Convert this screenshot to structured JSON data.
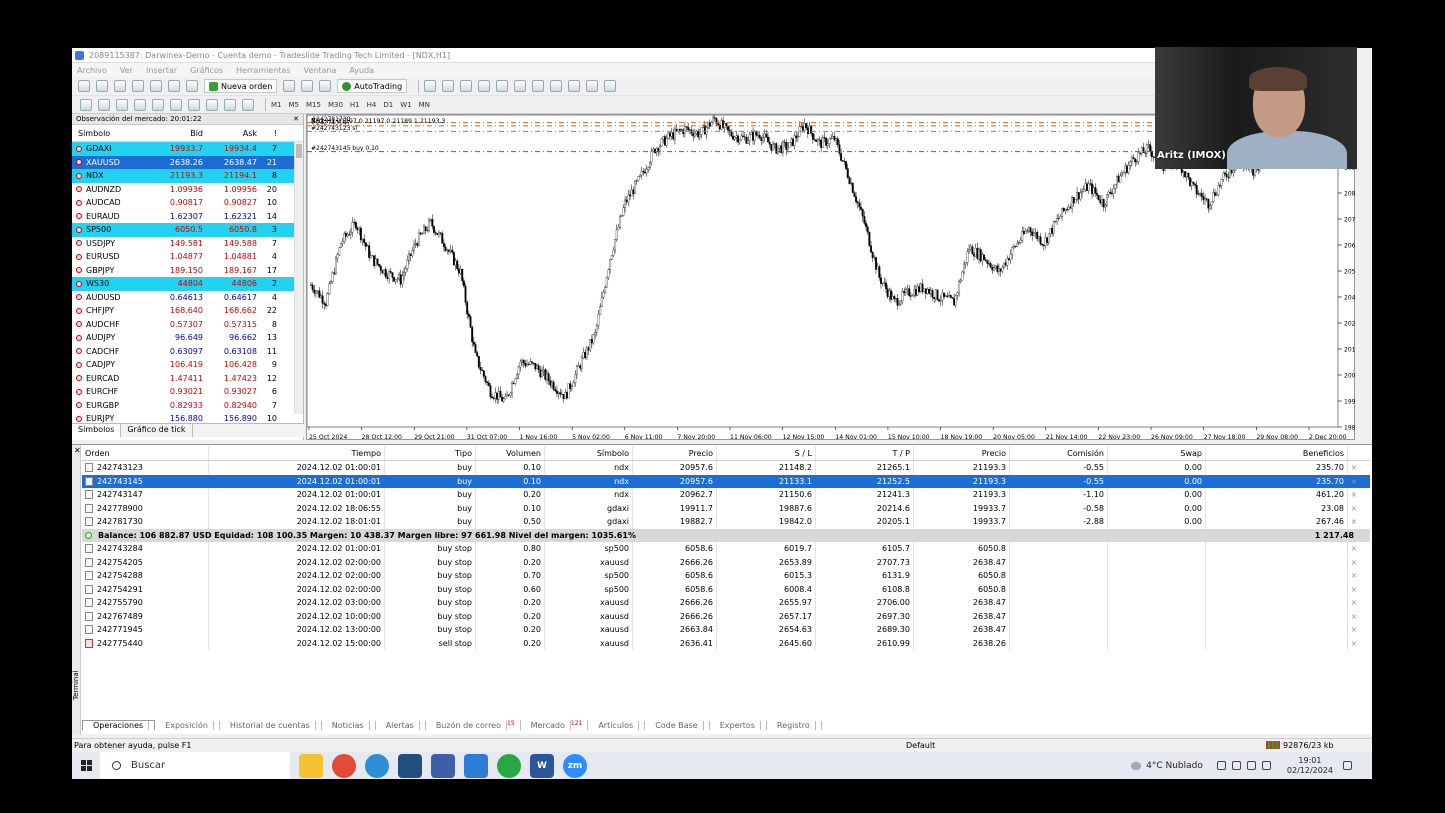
{
  "window": {
    "title": "2089115387: Darwinex-Demo - Cuenta demo - Tradeslide Trading Tech Limited - [NDX,H1]"
  },
  "menu": [
    "Archivo",
    "Ver",
    "Insertar",
    "Gráficos",
    "Herramientas",
    "Ventana",
    "Ayuda"
  ],
  "toolbar": {
    "new_order": "Nueva orden",
    "autotrading": "AutoTrading",
    "timeframes": [
      "M1",
      "M5",
      "M15",
      "M30",
      "H1",
      "H4",
      "D1",
      "W1",
      "MN"
    ]
  },
  "market_watch": {
    "title": "Observación del mercado: 20:01:22",
    "headers": {
      "symbol": "Símbolo",
      "bid": "Bid",
      "ask": "Ask",
      "spread": "!"
    },
    "rows": [
      {
        "symbol": "GDAXI",
        "bid": "19933.7",
        "ask": "19934.4",
        "spread": "7",
        "style": "hl"
      },
      {
        "symbol": "XAUUSD",
        "bid": "2638.26",
        "ask": "2638.47",
        "spread": "21",
        "style": "sel"
      },
      {
        "symbol": "NDX",
        "bid": "21193.3",
        "ask": "21194.1",
        "spread": "8",
        "style": "hl"
      },
      {
        "symbol": "AUDNZD",
        "bid": "1.09936",
        "ask": "1.09956",
        "spread": "20",
        "style": ""
      },
      {
        "symbol": "AUDCAD",
        "bid": "0.90817",
        "ask": "0.90827",
        "spread": "10",
        "style": ""
      },
      {
        "symbol": "EURAUD",
        "bid": "1.62307",
        "ask": "1.62321",
        "spread": "14",
        "style": "blue"
      },
      {
        "symbol": "SP500",
        "bid": "6050.5",
        "ask": "6050.8",
        "spread": "3",
        "style": "hl"
      },
      {
        "symbol": "USDJPY",
        "bid": "149.581",
        "ask": "149.588",
        "spread": "7",
        "style": ""
      },
      {
        "symbol": "EURUSD",
        "bid": "1.04877",
        "ask": "1.04881",
        "spread": "4",
        "style": ""
      },
      {
        "symbol": "GBPJPY",
        "bid": "189.150",
        "ask": "189.167",
        "spread": "17",
        "style": ""
      },
      {
        "symbol": "WS30",
        "bid": "44804",
        "ask": "44806",
        "spread": "2",
        "style": "hl"
      },
      {
        "symbol": "AUDUSD",
        "bid": "0.64613",
        "ask": "0.64617",
        "spread": "4",
        "style": "blue"
      },
      {
        "symbol": "CHFJPY",
        "bid": "168.640",
        "ask": "168.662",
        "spread": "22",
        "style": ""
      },
      {
        "symbol": "AUDCHF",
        "bid": "0.57307",
        "ask": "0.57315",
        "spread": "8",
        "style": ""
      },
      {
        "symbol": "AUDJPY",
        "bid": "96.649",
        "ask": "96.662",
        "spread": "13",
        "style": "blue"
      },
      {
        "symbol": "CADCHF",
        "bid": "0.63097",
        "ask": "0.63108",
        "spread": "11",
        "style": "blue"
      },
      {
        "symbol": "CADJPY",
        "bid": "106.419",
        "ask": "106.428",
        "spread": "9",
        "style": ""
      },
      {
        "symbol": "EURCAD",
        "bid": "1.47411",
        "ask": "1.47423",
        "spread": "12",
        "style": ""
      },
      {
        "symbol": "EURCHF",
        "bid": "0.93021",
        "ask": "0.93027",
        "spread": "6",
        "style": ""
      },
      {
        "symbol": "EURGBP",
        "bid": "0.82933",
        "ask": "0.82940",
        "spread": "7",
        "style": ""
      },
      {
        "symbol": "EURJPY",
        "bid": "156.880",
        "ask": "156.890",
        "spread": "10",
        "style": "blue"
      }
    ],
    "tabs": [
      "Símbolos",
      "Gráfico de tick"
    ]
  },
  "chart_data": {
    "type": "candlestick",
    "symbol_label": "NDX,H1  21197.0 21197.0 21189.1 21193.3",
    "ylim": [
      19876,
      21136
    ],
    "y_ticks": [
      "21031.0",
      "20926.0",
      "20821.0",
      "20716.0",
      "20611.0",
      "20506.0",
      "20401.0",
      "20296.0",
      "20191.0",
      "20086.0",
      "19981.0",
      "19876.0"
    ],
    "x_ticks": [
      "25 Oct 2024",
      "28 Oct 12:00",
      "29 Oct 21:00",
      "31 Oct 07:00",
      "1 Nov 16:00",
      "5 Nov 02:00",
      "6 Nov 11:00",
      "7 Nov 20:00",
      "11 Nov 06:00",
      "12 Nov 15:00",
      "14 Nov 01:00",
      "15 Nov 10:00",
      "18 Nov 19:00",
      "20 Nov 05:00",
      "21 Nov 14:00",
      "22 Nov 23:00",
      "26 Nov 09:00",
      "27 Nov 18:00",
      "29 Nov 08:00",
      "2 Dec 20:00"
    ],
    "price_path": [
      20450,
      20380,
      20620,
      20700,
      20560,
      20500,
      20470,
      20620,
      20700,
      20610,
      20500,
      20160,
      20020,
      19980,
      20140,
      20120,
      20060,
      20000,
      20130,
      20250,
      20560,
      20780,
      20880,
      21000,
      21050,
      21080,
      21060,
      21120,
      21060,
      21040,
      21060,
      21000,
      21010,
      21100,
      21020,
      21040,
      20880,
      20700,
      20480,
      20380,
      20420,
      20440,
      20400,
      20380,
      20600,
      20560,
      20500,
      20600,
      20680,
      20620,
      20720,
      20800,
      20850,
      20780,
      20880,
      20960,
      21000,
      20930,
      20950,
      20840,
      20780,
      20880,
      20950,
      20900,
      21000,
      20980,
      21080,
      21120,
      21193
    ],
    "order_lines": [
      {
        "label": "#242781730",
        "price": 21105,
        "color": "#d2691e"
      },
      {
        "label": "#242743147",
        "price": 21092,
        "color": "#d2691e"
      },
      {
        "label": "#242743123 sl",
        "price": 21070,
        "color": "#d2691e"
      },
      {
        "label": "#242743145 buy 0.10",
        "price": 20988,
        "color": "#228b22"
      }
    ]
  },
  "webcam": {
    "name": "Aritz (IMOX)"
  },
  "terminal": {
    "side_label": "Terminal",
    "headers": [
      "Orden",
      "Tiempo",
      "Tipo",
      "Volumen",
      "Símbolo",
      "Precio",
      "S / L",
      "T / P",
      "Precio",
      "Comisión",
      "Swap",
      "Beneficios"
    ],
    "positions": [
      {
        "order": "242743123",
        "time": "2024.12.02 01:00:01",
        "type": "buy",
        "volume": "0.10",
        "symbol": "ndx",
        "price": "20957.6",
        "sl": "21148.2",
        "tp": "21265.1",
        "cur": "21193.3",
        "commission": "-0.55",
        "swap": "0.00",
        "profit": "235.70",
        "selected": false
      },
      {
        "order": "242743145",
        "time": "2024.12.02 01:00:01",
        "type": "buy",
        "volume": "0.10",
        "symbol": "ndx",
        "price": "20957.6",
        "sl": "21133.1",
        "tp": "21252.5",
        "cur": "21193.3",
        "commission": "-0.55",
        "swap": "0.00",
        "profit": "235.70",
        "selected": true
      },
      {
        "order": "242743147",
        "time": "2024.12.02 01:00:01",
        "type": "buy",
        "volume": "0.20",
        "symbol": "ndx",
        "price": "20962.7",
        "sl": "21150.6",
        "tp": "21241.3",
        "cur": "21193.3",
        "commission": "-1.10",
        "swap": "0.00",
        "profit": "461.20",
        "selected": false
      },
      {
        "order": "242778900",
        "time": "2024.12.02 18:06:55",
        "type": "buy",
        "volume": "0.10",
        "symbol": "gdaxi",
        "price": "19911.7",
        "sl": "19887.6",
        "tp": "20214.6",
        "cur": "19933.7",
        "commission": "-0.58",
        "swap": "0.00",
        "profit": "23.08",
        "selected": false
      },
      {
        "order": "242781730",
        "time": "2024.12.02 18:01:01",
        "type": "buy",
        "volume": "0.50",
        "symbol": "gdaxi",
        "price": "19882.7",
        "sl": "19842.0",
        "tp": "20205.1",
        "cur": "19933.7",
        "commission": "-2.88",
        "swap": "0.00",
        "profit": "267.46",
        "selected": false
      }
    ],
    "balance_text": "Balance: 106 882.87 USD  Equidad: 108 100.35  Margen: 10 438.37  Margen libre: 97 661.98  Nivel del margen: 1035.61%",
    "balance_total": "1 217.48",
    "pending": [
      {
        "order": "242743284",
        "time": "2024.12.02 01:00:01",
        "type": "buy stop",
        "volume": "0.80",
        "symbol": "sp500",
        "price": "6058.6",
        "sl": "6019.7",
        "tp": "6105.7",
        "cur": "6050.8",
        "icon": "normal"
      },
      {
        "order": "242754205",
        "time": "2024.12.02 02:00:00",
        "type": "buy stop",
        "volume": "0.20",
        "symbol": "xauusd",
        "price": "2666.26",
        "sl": "2653.89",
        "tp": "2707.73",
        "cur": "2638.47",
        "icon": "normal"
      },
      {
        "order": "242754288",
        "time": "2024.12.02 02:00:00",
        "type": "buy stop",
        "volume": "0.70",
        "symbol": "sp500",
        "price": "6058.6",
        "sl": "6015.3",
        "tp": "6131.9",
        "cur": "6050.8",
        "icon": "normal"
      },
      {
        "order": "242754291",
        "time": "2024.12.02 02:00:00",
        "type": "buy stop",
        "volume": "0.60",
        "symbol": "sp500",
        "price": "6058.6",
        "sl": "6008.4",
        "tp": "6108.8",
        "cur": "6050.8",
        "icon": "normal"
      },
      {
        "order": "242755790",
        "time": "2024.12.02 03:00:00",
        "type": "buy stop",
        "volume": "0.20",
        "symbol": "xauusd",
        "price": "2666.26",
        "sl": "2655.97",
        "tp": "2706.00",
        "cur": "2638.47",
        "icon": "normal"
      },
      {
        "order": "242767489",
        "time": "2024.12.02 10:00:00",
        "type": "buy stop",
        "volume": "0.20",
        "symbol": "xauusd",
        "price": "2666.26",
        "sl": "2657.17",
        "tp": "2697.30",
        "cur": "2638.47",
        "icon": "normal"
      },
      {
        "order": "242771945",
        "time": "2024.12.02 13:00:00",
        "type": "buy stop",
        "volume": "0.20",
        "symbol": "xauusd",
        "price": "2663.84",
        "sl": "2654.63",
        "tp": "2689.30",
        "cur": "2638.47",
        "icon": "normal"
      },
      {
        "order": "242775440",
        "time": "2024.12.02 15:00:00",
        "type": "sell stop",
        "volume": "0.20",
        "symbol": "xauusd",
        "price": "2636.41",
        "sl": "2645.60",
        "tp": "2610.99",
        "cur": "2638.26",
        "icon": "red"
      }
    ],
    "tabs": [
      {
        "label": "Operaciones",
        "badge": ""
      },
      {
        "label": "Exposición",
        "badge": ""
      },
      {
        "label": "Historial de cuentas",
        "badge": ""
      },
      {
        "label": "Noticias",
        "badge": ""
      },
      {
        "label": "Alertas",
        "badge": ""
      },
      {
        "label": "Buzón de correo",
        "badge": "15"
      },
      {
        "label": "Mercado",
        "badge": "121"
      },
      {
        "label": "Artículos",
        "badge": ""
      },
      {
        "label": "Code Base",
        "badge": ""
      },
      {
        "label": "Expertos",
        "badge": ""
      },
      {
        "label": "Registro",
        "badge": ""
      }
    ]
  },
  "status": {
    "help": "Para obtener ayuda, pulse F1",
    "profile": "Default",
    "connection": "92876/23 kb"
  },
  "taskbar": {
    "search": "Buscar",
    "weather": "4°C  Nublado",
    "time": "19:01",
    "date": "02/12/2024"
  }
}
